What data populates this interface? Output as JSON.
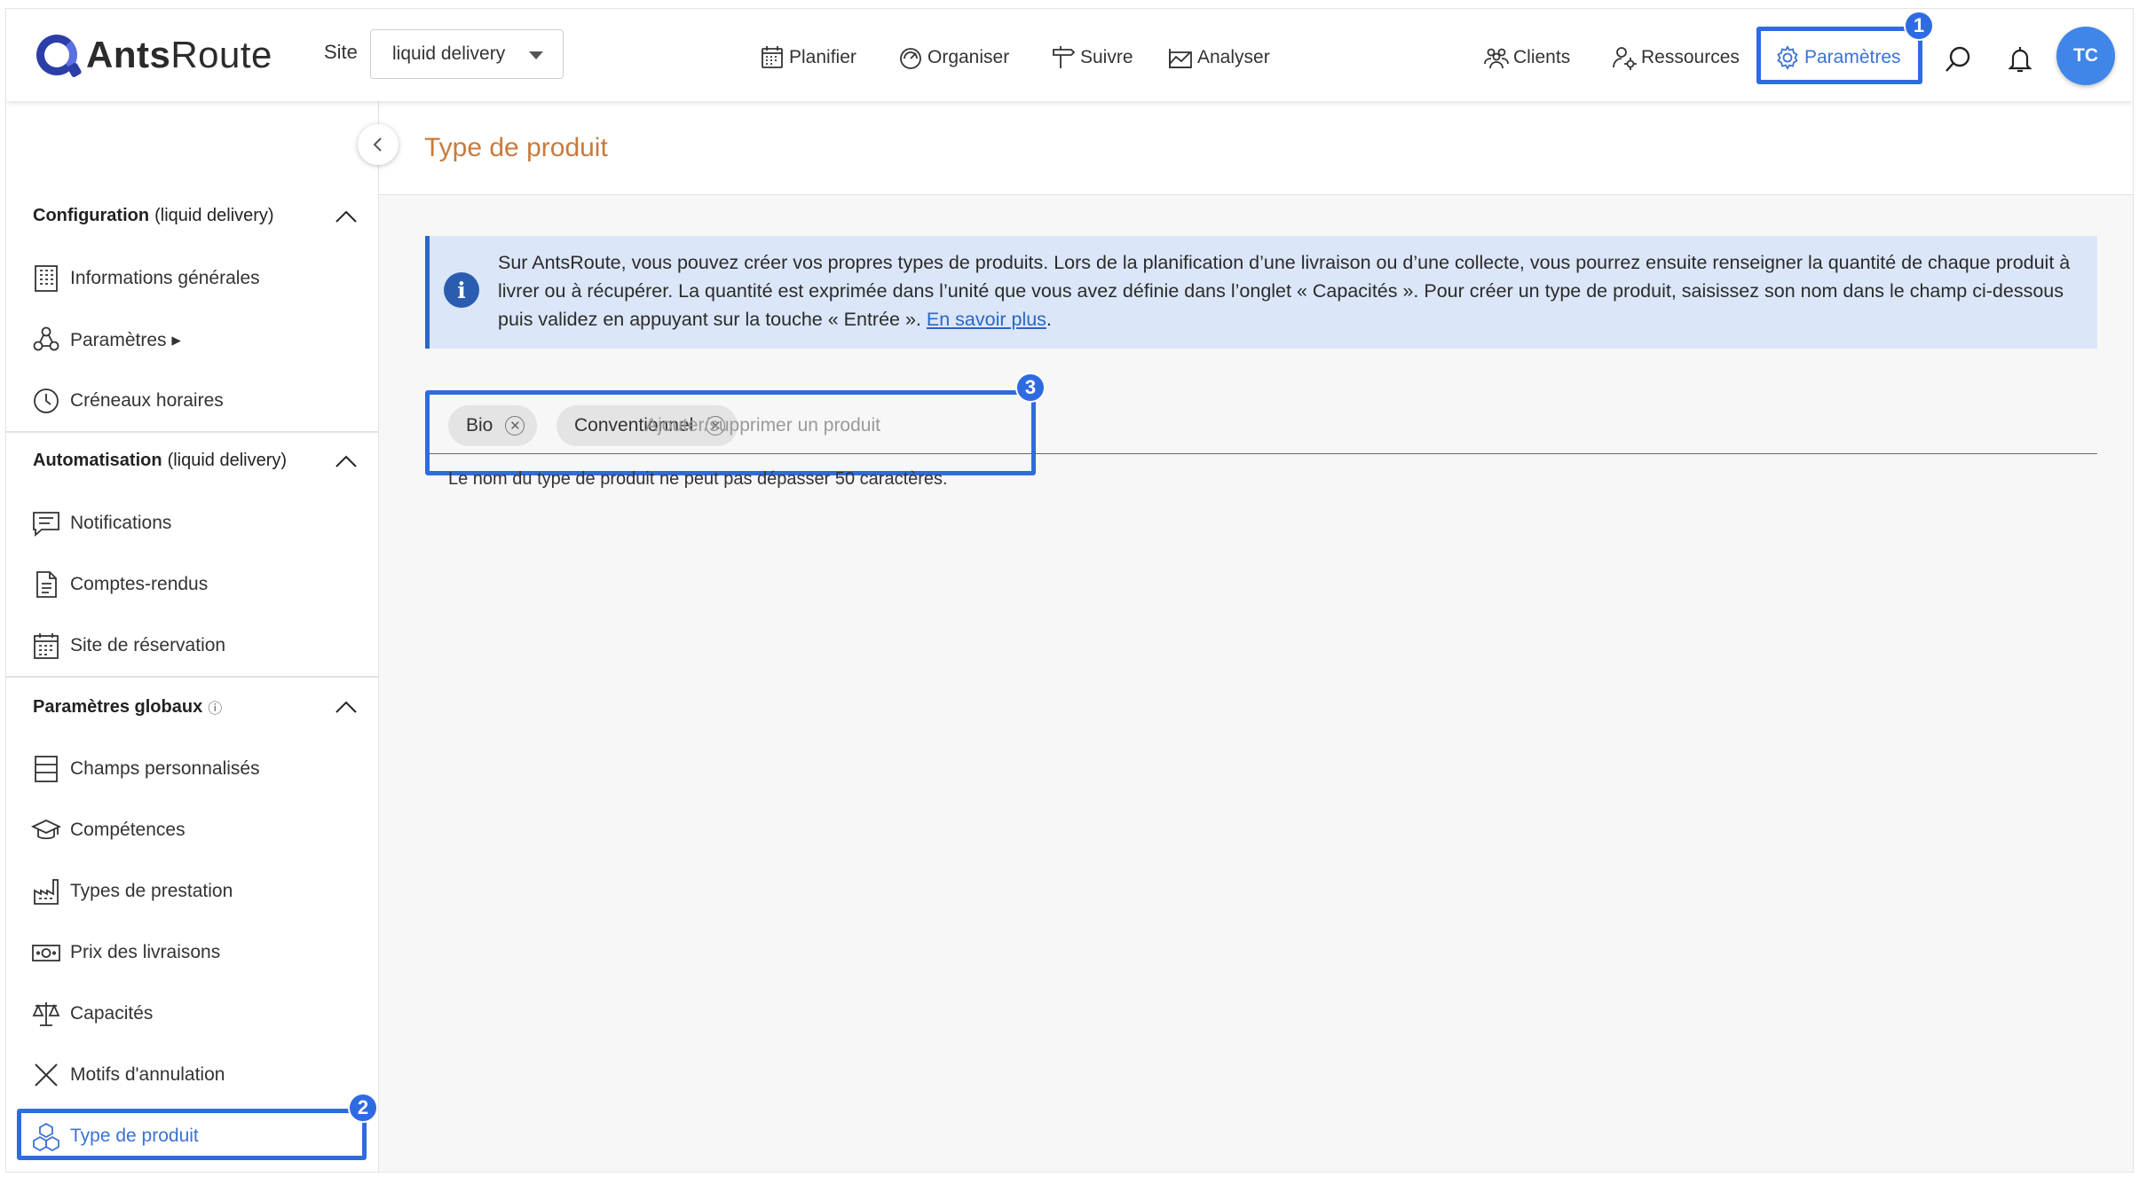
{
  "app": {
    "name_bold": "Ants",
    "name_rest": "Route"
  },
  "header": {
    "site_label": "Site",
    "site_value": "liquid delivery",
    "nav": [
      {
        "label": "Planifier",
        "icon": "calendar-icon"
      },
      {
        "label": "Organiser",
        "icon": "speedometer-icon"
      },
      {
        "label": "Suivre",
        "icon": "signpost-icon"
      },
      {
        "label": "Analyser",
        "icon": "chart-icon"
      }
    ],
    "right_nav": [
      {
        "label": "Clients",
        "icon": "people-icon"
      },
      {
        "label": "Ressources",
        "icon": "user-gear-icon"
      },
      {
        "label": "Paramètres",
        "icon": "gear-icon"
      }
    ],
    "avatar": "TC"
  },
  "annotations": {
    "one": "1",
    "two": "2",
    "three": "3"
  },
  "sidebar": {
    "sections": [
      {
        "title_bold": "Configuration",
        "title_rest": "(liquid delivery)",
        "items": [
          {
            "label": "Informations générales",
            "icon": "building-icon"
          },
          {
            "label": "Paramètres ▸",
            "icon": "nodes-icon"
          },
          {
            "label": "Créneaux horaires",
            "icon": "clock-icon"
          }
        ]
      },
      {
        "title_bold": "Automatisation",
        "title_rest": "(liquid delivery)",
        "items": [
          {
            "label": "Notifications",
            "icon": "message-icon"
          },
          {
            "label": "Comptes-rendus",
            "icon": "document-icon"
          },
          {
            "label": "Site de réservation",
            "icon": "calendar-grid-icon"
          }
        ]
      },
      {
        "title_bold": "Paramètres globaux",
        "title_rest": "ⓘ",
        "items": [
          {
            "label": "Champs personnalisés",
            "icon": "form-fields-icon"
          },
          {
            "label": "Compétences",
            "icon": "graduation-cap-icon"
          },
          {
            "label": "Types de prestation",
            "icon": "factory-icon"
          },
          {
            "label": "Prix des livraisons",
            "icon": "banknote-icon"
          },
          {
            "label": "Capacités",
            "icon": "scale-icon"
          },
          {
            "label": "Motifs d'annulation",
            "icon": "cross-icon"
          },
          {
            "label": "Type de produit",
            "icon": "boxes-icon",
            "active": true
          }
        ]
      }
    ]
  },
  "main": {
    "title": "Type de produit",
    "info_text": "Sur AntsRoute, vous pouvez créer vos propres types de produits. Lors de la planification d’une livraison ou d’une collecte, vous pourrez ensuite renseigner la quantité de chaque produit à livrer ou à récupérer. La quantité est exprimée dans l’unité que vous avez définie dans l’onglet « Capacités ». Pour créer un type de produit, saisissez son nom dans le champ ci-dessous puis validez en appuyant sur la touche « Entrée ».",
    "info_link": "En savoir plus",
    "chips": [
      "Bio",
      "Conventionnel"
    ],
    "input_placeholder": "Ajouter/supprimer un produit",
    "hint": "Le nom du type de produit ne peut pas dépasser 50 caractères."
  },
  "colors": {
    "accent": "#2f6be0",
    "title": "#c97a3c",
    "info_bg": "#dbe6f8"
  }
}
